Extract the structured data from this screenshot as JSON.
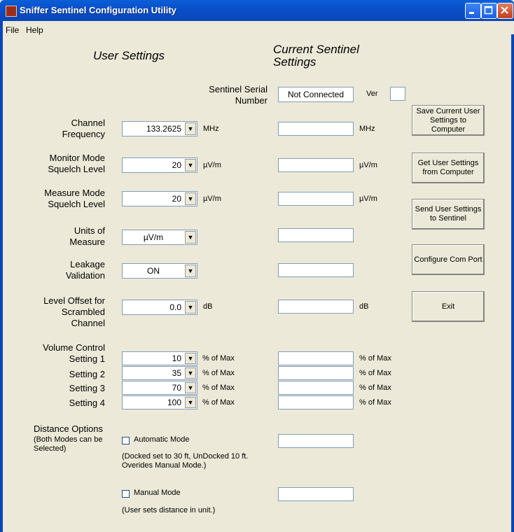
{
  "window": {
    "title": "Sniffer Sentinel Configuration Utility"
  },
  "menu": {
    "file": "File",
    "help": "Help"
  },
  "headers": {
    "user": "User Settings",
    "current_line1": "Current Sentinel",
    "current_line2": "Settings"
  },
  "serial": {
    "label_line1": "Sentinel Serial",
    "label_line2": "Number",
    "value": "Not Connected",
    "ver_label": "Ver",
    "ver_value": ""
  },
  "rows": {
    "channel": {
      "label_line1": "Channel",
      "label_line2": "Frequency",
      "value": "133.2625",
      "unit": "MHz",
      "current": "",
      "current_unit": "MHz"
    },
    "monitor": {
      "label_line1": "Monitor Mode",
      "label_line2": "Squelch Level",
      "value": "20",
      "unit": "µV/m",
      "current": "",
      "current_unit": "µV/m"
    },
    "measure": {
      "label_line1": "Measure Mode",
      "label_line2": "Squelch Level",
      "value": "20",
      "unit": "µV/m",
      "current": "",
      "current_unit": "µV/m"
    },
    "units": {
      "label_line1": "Units of",
      "label_line2": "Measure",
      "value": "µV/m",
      "current": ""
    },
    "leakage": {
      "label_line1": "Leakage",
      "label_line2": "Validation",
      "value": "ON",
      "current": ""
    },
    "offset": {
      "label_line1": "Level Offset for",
      "label_line2": "Scrambled",
      "label_line3": "Channel",
      "value": "0.0",
      "unit": "dB",
      "current": "",
      "current_unit": "dB"
    }
  },
  "volume": {
    "title": "Volume Control",
    "unit": "% of Max",
    "settings": [
      {
        "label": "Setting 1",
        "value": "10",
        "current": ""
      },
      {
        "label": "Setting 2",
        "value": "35",
        "current": ""
      },
      {
        "label": "Setting 3",
        "value": "70",
        "current": ""
      },
      {
        "label": "Setting 4",
        "value": "100",
        "current": ""
      }
    ]
  },
  "distance": {
    "title": "Distance Options",
    "subtitle_line1": "(Both Modes can be",
    "subtitle_line2": "Selected)",
    "automatic": {
      "label": "Automatic Mode",
      "checked": false,
      "note_line1": "(Docked set to 30 ft, UnDocked 10 ft.",
      "note_line2": "Overides Manual Mode.)",
      "current": ""
    },
    "manual": {
      "label": "Manual Mode",
      "checked": false,
      "note": "(User sets distance in unit.)",
      "current": ""
    }
  },
  "buttons": {
    "save": "Save Current User Settings to Computer",
    "get": "Get User Settings from Computer",
    "send": "Send User Settings to Sentinel",
    "configure": "Configure Com Port",
    "exit": "Exit"
  },
  "icons": {
    "app": "app-icon",
    "dropdown": "chevron-down-icon"
  }
}
